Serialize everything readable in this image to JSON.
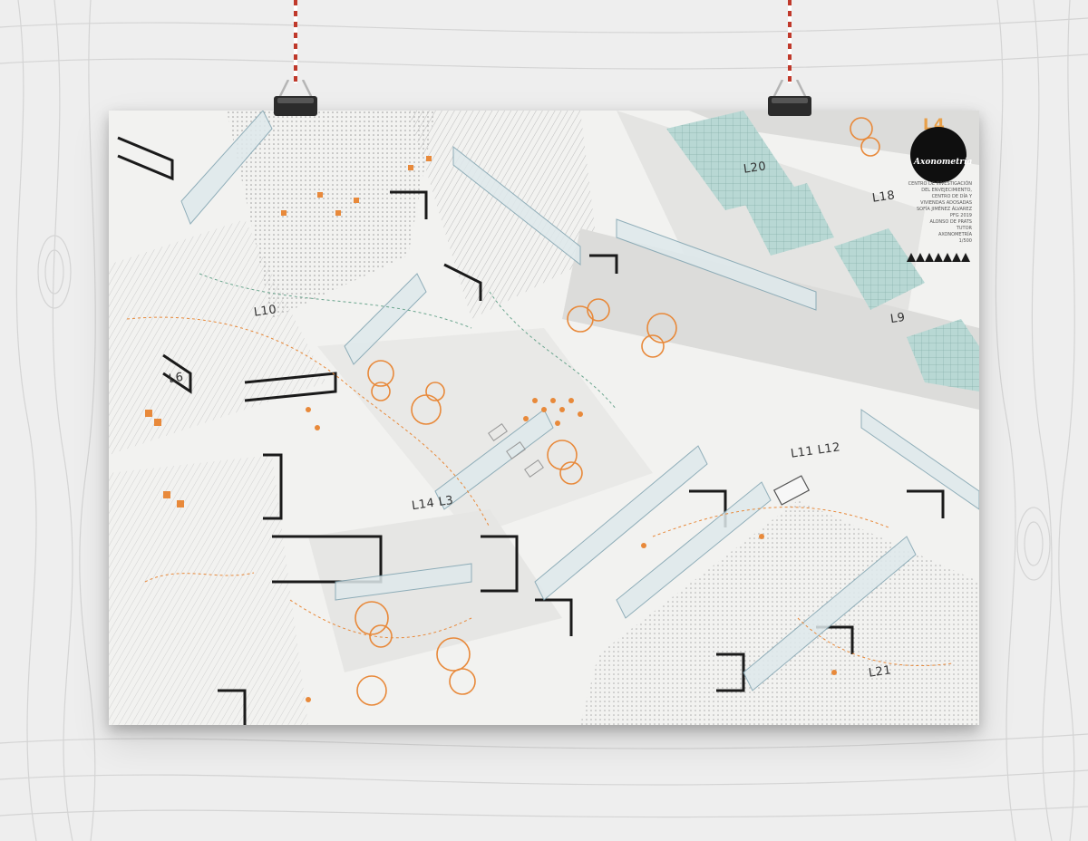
{
  "poster": {
    "badge_title": "Axonometría",
    "logo_mark": "L4",
    "info_lines": [
      "CENTRO DE INVESTIGACIÓN",
      "DEL ENVEJECIMIENTO,",
      "CENTRO DE DÍA Y",
      "VIVIENDAS ADOSADAS",
      "SOFÍA JIMÉNEZ ÁLVAREZ",
      "PFG 2019",
      "ALONSO DE PRATS",
      "TUTOR",
      "AXONOMETRÍA",
      "1/500"
    ],
    "plan_labels": [
      "L20",
      "L18",
      "L9",
      "L10",
      "L6",
      "L11 L12",
      "L14 L3",
      "L21"
    ]
  },
  "colors": {
    "wall": "#ececec",
    "paper": "#f2f2f0",
    "accent_orange": "#e8893a",
    "glass_teal": "#b8d8d4",
    "line_dark": "#1a1a1a",
    "badge": "#0f0f0f",
    "strap_red": "#c0392b"
  },
  "icons": [
    "binder-clip-icon",
    "binder-clip-icon"
  ]
}
